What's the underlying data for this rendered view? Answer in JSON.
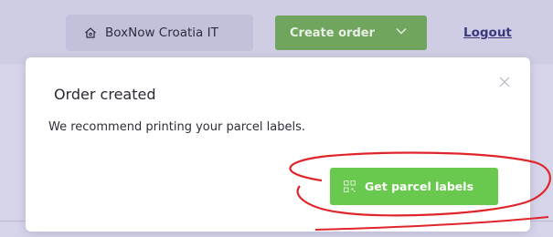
{
  "header": {
    "account_name": "BoxNow Croatia IT",
    "account_icon": "home-icon",
    "create_order_label": "Create order",
    "create_order_icon": "chevron-down-icon",
    "logout_label": "Logout"
  },
  "modal": {
    "title": "Order created",
    "message": "We recommend printing your parcel labels.",
    "close_icon": "close-icon",
    "primary_button": {
      "label": "Get parcel labels",
      "icon": "qr-code-icon"
    }
  },
  "annotation": {
    "type": "highlight-ellipse",
    "target": "get-parcel-labels-button",
    "color": "#e0252a"
  },
  "colors": {
    "primary_green": "#69c94f",
    "nav_background": "#cfcde4",
    "link": "#3c3a7e"
  }
}
